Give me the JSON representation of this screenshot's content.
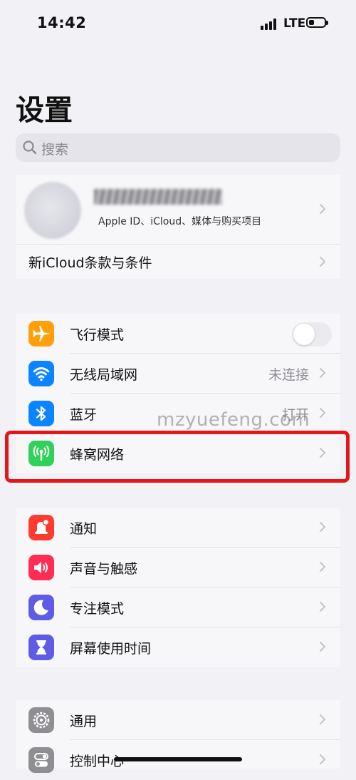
{
  "status_bar": {
    "time": "14:42",
    "network": "LTE",
    "battery_level": 0.35
  },
  "page_title": "设置",
  "search": {
    "placeholder": "搜索"
  },
  "account": {
    "subtitle": "Apple ID、iCloud、媒体与购买项目"
  },
  "icloud_terms": {
    "label": "新iCloud条款与条件"
  },
  "connectivity": [
    {
      "label": "飞行模式",
      "icon": "airplane-icon",
      "color": "#ff9f0a",
      "toggle": false
    },
    {
      "label": "无线局域网",
      "icon": "wifi-icon",
      "color": "#0a84ff",
      "value": "未连接"
    },
    {
      "label": "蓝牙",
      "icon": "bluetooth-icon",
      "color": "#0a84ff",
      "value": "打开"
    },
    {
      "label": "蜂窝网络",
      "icon": "cellular-icon",
      "color": "#30d158"
    }
  ],
  "notifications": [
    {
      "label": "通知",
      "icon": "notification-icon",
      "color": "#ff3b30"
    },
    {
      "label": "声音与触感",
      "icon": "sound-icon",
      "color": "#ff2d55"
    },
    {
      "label": "专注模式",
      "icon": "moon-icon",
      "color": "#5e5ce6"
    },
    {
      "label": "屏幕使用时间",
      "icon": "hourglass-icon",
      "color": "#5e5ce6"
    }
  ],
  "general": [
    {
      "label": "通用",
      "icon": "gear-icon",
      "color": "#8e8e93"
    },
    {
      "label": "控制中心",
      "icon": "control-center-icon",
      "color": "#8e8e93"
    }
  ],
  "watermark": "mzyuefeng.com",
  "colors": {
    "highlight": "#e5161a",
    "background": "#f2f2f6"
  }
}
